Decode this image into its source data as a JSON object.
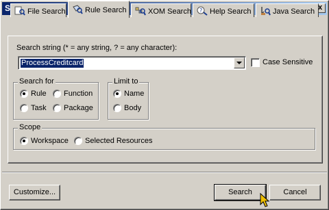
{
  "window": {
    "title": "Search",
    "close_glyph": "x"
  },
  "tabs": [
    {
      "label": "File Search",
      "icon": "file-search-icon",
      "active": false
    },
    {
      "label": "Rule Search",
      "icon": "rule-search-icon",
      "active": true
    },
    {
      "label": "XOM Search",
      "icon": "xom-search-icon",
      "active": false
    },
    {
      "label": "Help Search",
      "icon": "help-search-icon",
      "active": false
    },
    {
      "label": "Java Search",
      "icon": "java-search-icon",
      "active": false
    }
  ],
  "search": {
    "label": "Search string (* = any string, ? = any character):",
    "value": "ProcessCreditcard",
    "case_sensitive_label": "Case Sensitive",
    "case_sensitive_checked": false
  },
  "search_for": {
    "title": "Search for",
    "options": [
      {
        "label": "Rule",
        "selected": true
      },
      {
        "label": "Function",
        "selected": false
      },
      {
        "label": "Task",
        "selected": false
      },
      {
        "label": "Package",
        "selected": false
      }
    ]
  },
  "limit_to": {
    "title": "Limit to",
    "options": [
      {
        "label": "Name",
        "selected": true
      },
      {
        "label": "Body",
        "selected": false
      }
    ]
  },
  "scope": {
    "title": "Scope",
    "options": [
      {
        "label": "Workspace",
        "selected": true
      },
      {
        "label": "Selected Resources",
        "selected": false
      }
    ]
  },
  "buttons": {
    "customize": "Customize...",
    "search": "Search",
    "cancel": "Cancel"
  },
  "colors": {
    "title_start": "#0a246a",
    "title_end": "#a6caf0",
    "face": "#d4d0c8",
    "selection": "#0a246a"
  }
}
